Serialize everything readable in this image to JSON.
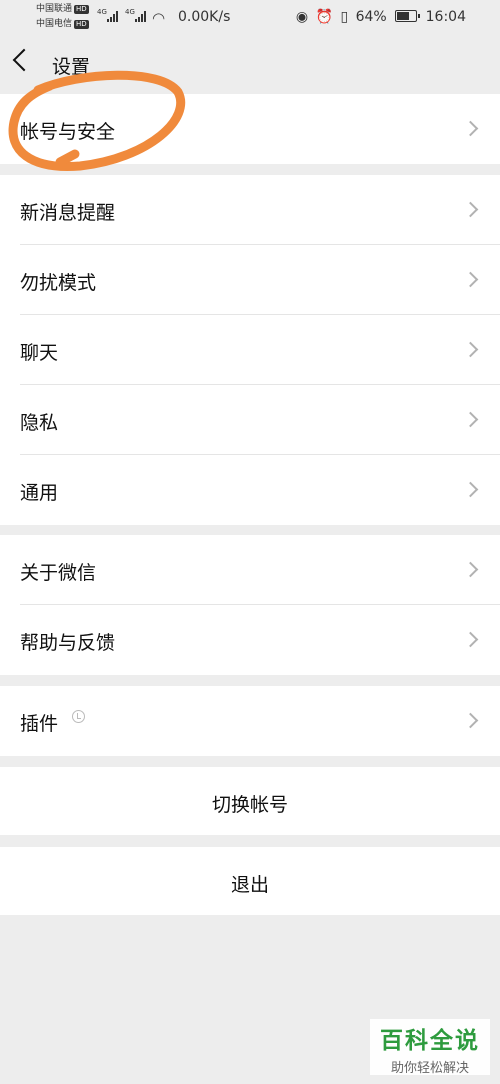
{
  "status_bar": {
    "carrier_1": "中国联通",
    "carrier_2": "中国电信",
    "hd": "HD",
    "net_type": "4G",
    "speed": "0.00K/s",
    "battery_percent": "64%",
    "time": "16:04"
  },
  "header": {
    "title": "设置"
  },
  "groups": [
    {
      "items": [
        {
          "label": "帐号与安全"
        }
      ]
    },
    {
      "items": [
        {
          "label": "新消息提醒"
        },
        {
          "label": "勿扰模式"
        },
        {
          "label": "聊天"
        },
        {
          "label": "隐私"
        },
        {
          "label": "通用"
        }
      ]
    },
    {
      "items": [
        {
          "label": "关于微信"
        },
        {
          "label": "帮助与反馈"
        }
      ]
    },
    {
      "items": [
        {
          "label": "插件"
        }
      ]
    }
  ],
  "actions": {
    "switch_account": "切换帐号",
    "logout": "退出"
  },
  "watermark": {
    "title": "百科全说",
    "subtitle": "助你轻松解决"
  },
  "colors": {
    "background": "#ededed",
    "annotation": "#f08a3c",
    "watermark_green": "#2e9b3e"
  }
}
